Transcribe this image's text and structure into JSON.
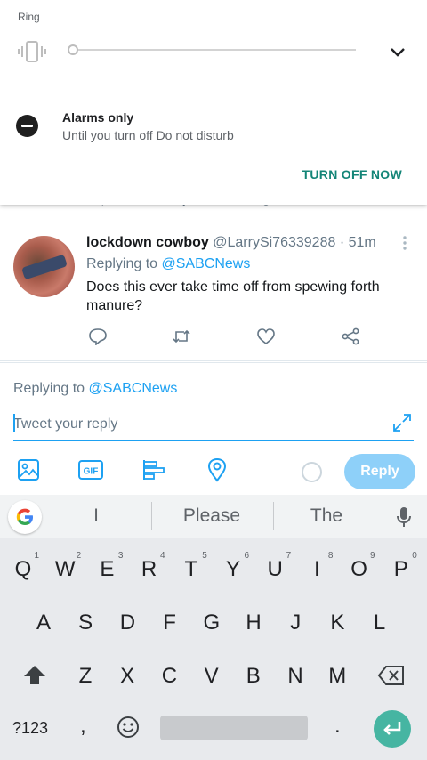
{
  "volume_panel": {
    "stream_label": "Ring",
    "volume_level": 0.0
  },
  "dnd": {
    "title": "Alarms only",
    "subtitle": "Until you turn off Do not disturb",
    "turn_off_label": "TURN OFF NOW"
  },
  "tweet": {
    "author_name": "lockdown cowboy",
    "author_handle": "@LarrySi76339288",
    "separator": "·",
    "time": "51m",
    "replying_prefix": "Replying to ",
    "replying_to": "@SABCNews",
    "text": "Does this ever take time off from spewing forth manure?",
    "actions": [
      "reply-icon",
      "retweet-icon",
      "like-icon",
      "share-icon"
    ]
  },
  "composer": {
    "replying_prefix": "Replying to ",
    "replying_to": "@SABCNews",
    "placeholder": "Tweet your reply",
    "reply_label": "Reply",
    "tools": [
      "image-icon",
      "gif-icon",
      "poll-icon",
      "location-icon"
    ],
    "gif_text": "GIF"
  },
  "keyboard": {
    "suggestions": [
      "I",
      "Please",
      "The"
    ],
    "row1": [
      {
        "k": "Q",
        "n": "1"
      },
      {
        "k": "W",
        "n": "2"
      },
      {
        "k": "E",
        "n": "3"
      },
      {
        "k": "R",
        "n": "4"
      },
      {
        "k": "T",
        "n": "5"
      },
      {
        "k": "Y",
        "n": "6"
      },
      {
        "k": "U",
        "n": "7"
      },
      {
        "k": "I",
        "n": "8"
      },
      {
        "k": "O",
        "n": "9"
      },
      {
        "k": "P",
        "n": "0"
      }
    ],
    "row2": [
      "A",
      "S",
      "D",
      "F",
      "G",
      "H",
      "J",
      "K",
      "L"
    ],
    "row3": [
      "Z",
      "X",
      "C",
      "V",
      "B",
      "N",
      "M"
    ],
    "symbols_label": "?123",
    "comma": ",",
    "period": "."
  },
  "colors": {
    "accent": "#1da1f2",
    "reply_button": "#8ed0f9",
    "dnd_action": "#138577",
    "enter_key": "#46b5a2"
  }
}
